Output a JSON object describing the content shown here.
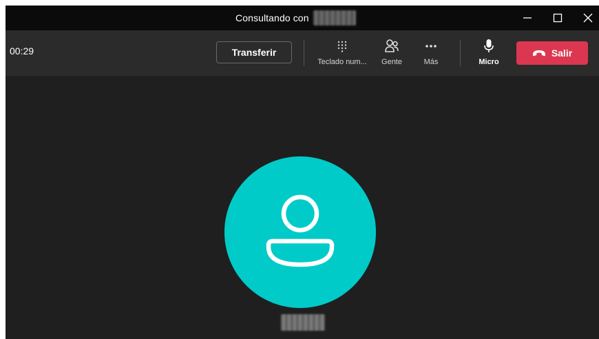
{
  "window": {
    "title": "Consultando con",
    "controls": {
      "minimize": "minimize-icon",
      "maximize": "maximize-icon",
      "close": "close-icon"
    }
  },
  "toolbar": {
    "timer": "00:29",
    "transfer_label": "Transferir",
    "tools": [
      {
        "label": "Teclado num...",
        "icon": "dialpad-icon"
      },
      {
        "label": "Gente",
        "icon": "people-icon"
      },
      {
        "label": "Más",
        "icon": "more-icon"
      },
      {
        "label": "Micro",
        "icon": "microphone-icon"
      }
    ],
    "leave_label": "Salir",
    "leave_icon": "hang-up-icon"
  },
  "stage": {
    "avatar_icon": "person-icon"
  },
  "colors": {
    "titlebar": "#0b0b0b",
    "toolbar": "#2b2b2b",
    "stage": "#1f1f1f",
    "avatar": "#00cbc8",
    "leave_button": "#dc3750"
  }
}
